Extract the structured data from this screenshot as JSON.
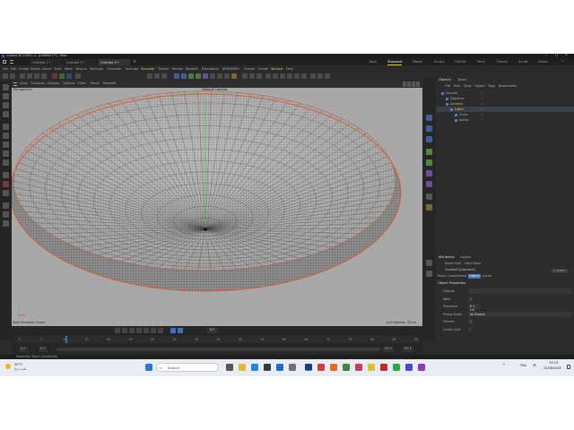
{
  "app": {
    "title": "Cinema 4D 2026.1.4 - [Untitled 3 *] - Main",
    "tabs": [
      "Untitled 1 *",
      "Untitled 2 *",
      "Untitled 3 *"
    ],
    "active_tab_index": 2,
    "layouts": [
      "Tools",
      "Standard",
      "Model",
      "Sculpt",
      "UVEdit",
      "Paint",
      "Groom",
      "Script",
      "Nodes"
    ],
    "active_layout": "Standard",
    "accent": "#e6c84a"
  },
  "menubar": [
    "File",
    "Edit",
    "Create",
    "Modes",
    "Select",
    "Tools",
    "Mesh",
    "Volume",
    "MoGraph",
    "Character",
    "Animate",
    "Simulate",
    "Tracker",
    "Render",
    "Redshift",
    "Extensions",
    "RENDERER",
    "Octane",
    "Window",
    "Help"
  ],
  "menubar_highlight": [
    "Simulate",
    "Window"
  ],
  "viewport": {
    "menu": [
      "View",
      "Cameras",
      "Display",
      "Options",
      "Filter",
      "Panel",
      "Redshift"
    ],
    "label": "Perspective",
    "camera": "Default Camera",
    "status_left": "View Transform: Scene",
    "status_right": "Grid Spacing : 50 cm"
  },
  "objects_panel": {
    "tabs": [
      "Objects",
      "Takes"
    ],
    "menu": [
      "File",
      "Edit",
      "View",
      "Object",
      "Tags",
      "Bookmarks"
    ],
    "items": [
      {
        "name": "Extrude",
        "indent": 0,
        "color": "#9fb0c8"
      },
      {
        "name": "Displacer",
        "indent": 1,
        "color": "#9fb0c8"
      },
      {
        "name": "Connect",
        "indent": 1,
        "color": "#e6c84a"
      },
      {
        "name": "Lathe",
        "indent": 2,
        "color": "#e6c84a"
      },
      {
        "name": "Circle",
        "indent": 3,
        "color": "#9fb0c8"
      },
      {
        "name": "Spline",
        "indent": 3,
        "color": "#9fb0c8"
      }
    ]
  },
  "attributes_panel": {
    "tabs": [
      "Attributes",
      "Layers"
    ],
    "menu": [
      "Mode",
      "Edit",
      "User Data"
    ],
    "object_label": "Connect [Connect]",
    "preset": "Custom",
    "subtabs": [
      "Basic",
      "Coordinates",
      "Object",
      "Cache"
    ],
    "active_subtab": "Object",
    "section": "Object Properties",
    "fields": [
      {
        "label": "Objects",
        "value": ""
      },
      {
        "label": "Weld",
        "value": "✓"
      },
      {
        "label": "Tolerance",
        "value": "0.1 cm"
      },
      {
        "label": "Phong Mode",
        "value": "All Breaks"
      },
      {
        "label": "Texture",
        "value": "✓"
      },
      {
        "label": "Center Axis",
        "value": ""
      }
    ]
  },
  "timeline": {
    "ruler": [
      "0",
      "5",
      "10",
      "15",
      "20",
      "25",
      "30",
      "35",
      "40",
      "45",
      "50",
      "55",
      "60",
      "65",
      "70",
      "75",
      "80",
      "85",
      "90"
    ],
    "current_frame": "0 F",
    "start": "0 F",
    "end": "90 F",
    "preview_end": "90 F",
    "start2": "0 F",
    "mid": "0 F"
  },
  "statusbar": {
    "text": "Subdivide Object (Subdivide)"
  },
  "taskbar": {
    "weather_temp": "30°C",
    "weather_text": "غائم جزئياً",
    "search": "Search",
    "language": "FRA",
    "time": "13:19",
    "date": "22/08/2026"
  }
}
